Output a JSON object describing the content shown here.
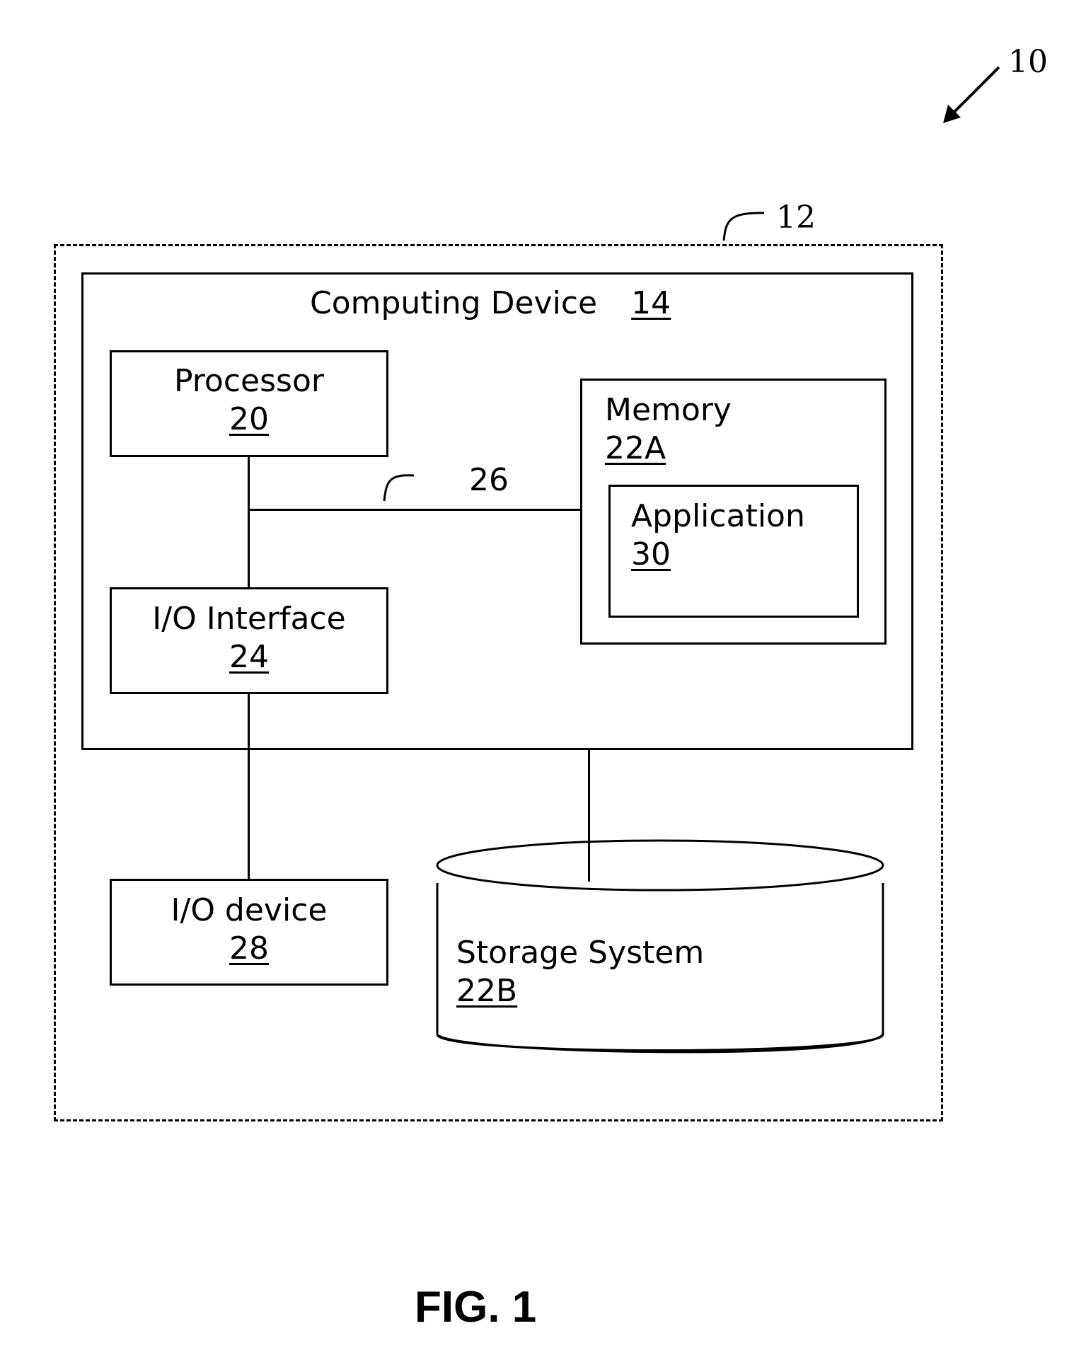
{
  "figure": {
    "caption": "FIG. 1",
    "system_ref": "10",
    "environment_ref": "12",
    "bus_ref": "26"
  },
  "computing_device": {
    "title": "Computing Device",
    "ref": "14"
  },
  "processor": {
    "title": "Processor",
    "ref": "20"
  },
  "io_interface": {
    "title": "I/O Interface",
    "ref": "24"
  },
  "memory": {
    "title": "Memory",
    "ref": "22A"
  },
  "application": {
    "title": "Application",
    "ref": "30"
  },
  "io_device": {
    "title": "I/O device",
    "ref": "28"
  },
  "storage_system": {
    "title": "Storage System",
    "ref": "22B"
  }
}
